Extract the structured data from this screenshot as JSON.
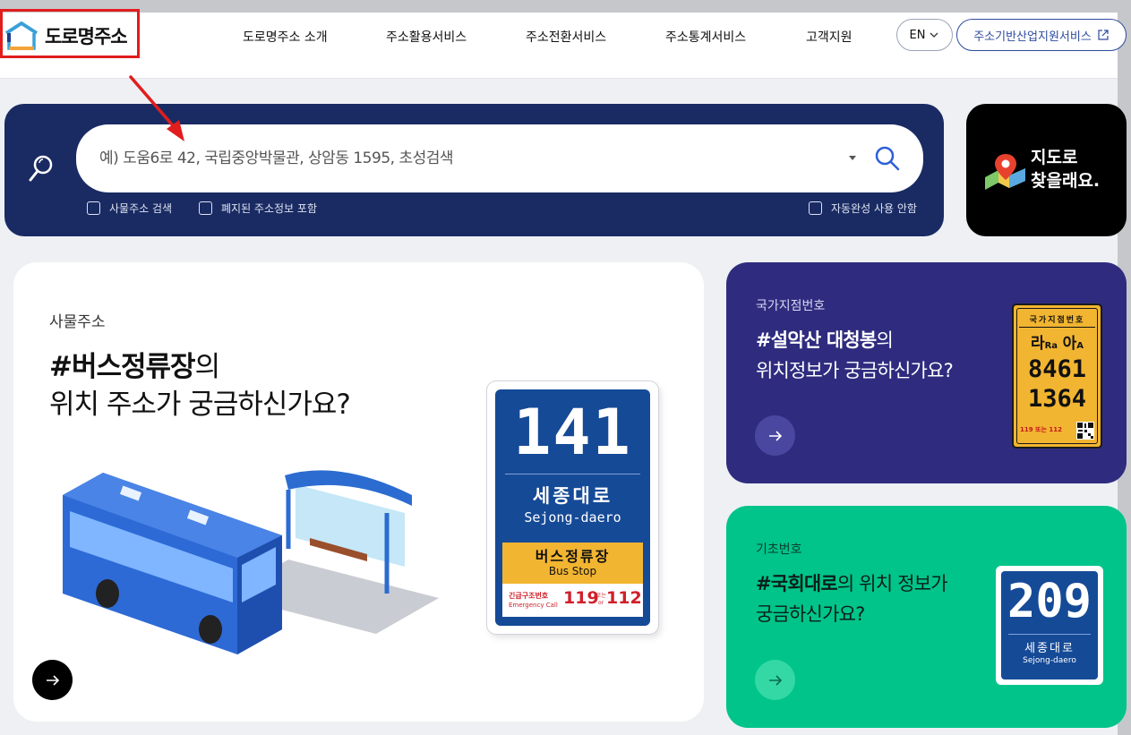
{
  "header": {
    "logo_text": "도로명주소",
    "nav": [
      "도로명주소 소개",
      "주소활용서비스",
      "주소전환서비스",
      "주소통계서비스",
      "고객지원"
    ],
    "lang_label": "EN",
    "external_label": "주소기반산업지원서비스"
  },
  "search": {
    "placeholder": "예) 도움6로 42, 국립중앙박물관, 상암동 1595, 초성검색",
    "options": [
      "사물주소 검색",
      "폐지된 주소정보 포함",
      "자동완성 사용 안함"
    ]
  },
  "map_card": {
    "line1": "지도로",
    "line2": "찾을래요."
  },
  "main_card": {
    "category": "사물주소",
    "title_bold": "#버스정류장",
    "title_rest": "의",
    "title_line2": "위치 주소가 궁금하신가요?",
    "sign": {
      "number": "141",
      "road_ko": "세종대로",
      "road_en": "Sejong-daero",
      "stop_ko": "버스정류장",
      "stop_en": "Bus Stop",
      "emergency_ko": "긴급구조번호",
      "emergency_en": "Emergency Call",
      "num1": "119",
      "or_ko": "또는",
      "or_en": "or",
      "num2": "112"
    }
  },
  "purple_card": {
    "category": "국가지점번호",
    "title_bold": "#설악산 대청봉",
    "title_rest": "의",
    "title_line2": "위치정보가 궁금하신가요?",
    "sign": {
      "header": "국가지점번호",
      "line1_a": "라",
      "line1_b": "Ra",
      "line1_c": "아",
      "line1_d": "A",
      "line2": "8461",
      "line3": "1364",
      "nums": "119 또는 112"
    }
  },
  "green_card": {
    "category": "기초번호",
    "title_bold": "#국회대로",
    "title_rest": "의 위치 정보가",
    "title_line2": "궁금하신가요?",
    "sign": {
      "number": "209",
      "road_ko": "세종대로",
      "road_en": "Sejong-daero"
    }
  },
  "colors": {
    "navy": "#1a2b63",
    "purple": "#2f2c7f",
    "green": "#00c48a",
    "sign_blue": "#154a97",
    "sign_yellow": "#f2b531",
    "highlight_red": "#e11d1d"
  }
}
